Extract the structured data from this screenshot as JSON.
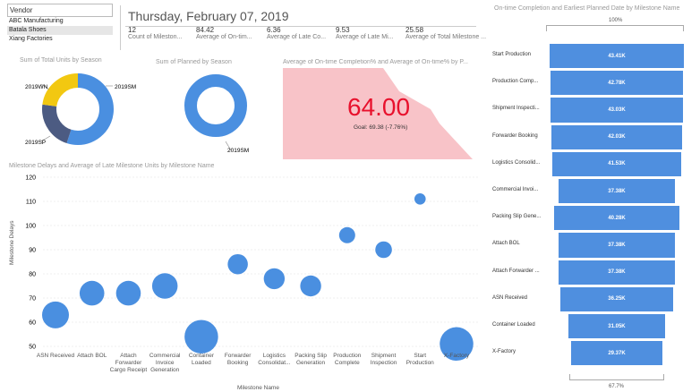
{
  "vendor": {
    "header": "Vendor",
    "items": [
      "ABC Manufacturing",
      "Batala Shoes",
      "Xiang Factories"
    ],
    "selected_index": 1
  },
  "header": {
    "date": "Thursday, February 07, 2019",
    "kpis": [
      {
        "value": "12",
        "label": "Count of Mileston..."
      },
      {
        "value": "84.42",
        "label": "Average of On-tim..."
      },
      {
        "value": "6.36",
        "label": "Average of Late Co..."
      },
      {
        "value": "9.53",
        "label": "Average of Late Mi..."
      },
      {
        "value": "25.58",
        "label": "Average of Total Milestone ..."
      }
    ]
  },
  "donut1": {
    "title": "Sum of Total Units by Season",
    "labels": {
      "wn": "2019WN",
      "sm": "2019SM",
      "sp": "2019SP"
    },
    "slices": [
      {
        "name": "2019SM",
        "fraction": 0.55,
        "color": "#4a8fe0"
      },
      {
        "name": "2019SP",
        "fraction": 0.22,
        "color": "#4c5b82"
      },
      {
        "name": "2019WN",
        "fraction": 0.23,
        "color": "#f2c811"
      }
    ]
  },
  "donut2": {
    "title": "Sum of Planned by Season",
    "label": "2019SM",
    "color": "#4a8fe0"
  },
  "gauge": {
    "title": "Average of On-time Completion% and Average of On-time% by P...",
    "value": "64.00",
    "goal": "Goal: 69.38 (-7.76%)",
    "value_color": "#e8112d",
    "fill_color": "#f8c3c8"
  },
  "scatter": {
    "title": "Milestone Delays and Average of Late Milestone Units by Milestone Name",
    "xlabel": "Milestone Name",
    "ylabel": "Milestone Delays",
    "yticks": [
      "120",
      "110",
      "100",
      "90",
      "80",
      "70",
      "60",
      "50"
    ]
  },
  "chart_data": [
    {
      "type": "scatter",
      "title": "Milestone Delays and Average of Late Milestone Units by Milestone Name",
      "xlabel": "Milestone Name",
      "ylabel": "Milestone Delays",
      "ylim": [
        50,
        120
      ],
      "categories": [
        "ASN Received",
        "Attach BOL",
        "Attach Forwarder Cargo Receipt",
        "Commercial Invoice Generation",
        "Container Loaded",
        "Forwarder Booking",
        "Logistics Consolidat...",
        "Packing Slip Generation",
        "Production Complete",
        "Shipment Inspection",
        "Start Production",
        "X-Factory"
      ],
      "y": [
        63,
        72,
        72,
        75,
        54,
        84,
        78,
        75,
        96,
        90,
        111,
        51
      ],
      "size_rel": [
        1.0,
        0.92,
        0.92,
        0.95,
        1.25,
        0.75,
        0.78,
        0.78,
        0.6,
        0.62,
        0.42,
        1.25
      ],
      "color": "#4a8fe0"
    },
    {
      "type": "bar",
      "title": "On-time Completion and Earliest Planned Date by Milestone Name",
      "orientation": "funnel",
      "top_label": "100%",
      "bottom_label": "67.7%",
      "categories": [
        "Start Production",
        "Production Comp...",
        "Shipment Inspecti...",
        "Forwarder Booking",
        "Logistics Consolid...",
        "Commercial Invoi...",
        "Packing Slip Gene...",
        "Attach BOL",
        "Attach Forwarder ...",
        "ASN Received",
        "Container Loaded",
        "X-Factory"
      ],
      "values": [
        43.41,
        42.78,
        43.03,
        42.03,
        41.53,
        37.38,
        40.28,
        37.38,
        37.38,
        36.25,
        31.05,
        29.37
      ],
      "value_labels": [
        "43.41K",
        "42.78K",
        "43.03K",
        "42.03K",
        "41.53K",
        "37.38K",
        "40.28K",
        "37.38K",
        "37.38K",
        "36.25K",
        "31.05K",
        "29.37K"
      ],
      "color": "#4a8fe0"
    }
  ]
}
